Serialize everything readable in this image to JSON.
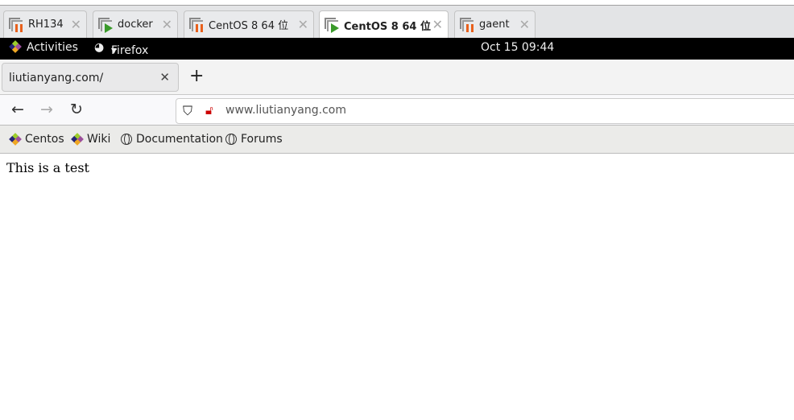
{
  "vm_tabs": [
    {
      "label": "RH134",
      "state": "paused"
    },
    {
      "label": "docker",
      "state": "running"
    },
    {
      "label": "CentOS 8 64 位",
      "state": "paused"
    },
    {
      "label": "CentOS 8 64 位",
      "state": "running",
      "active": true
    },
    {
      "label": "gaent",
      "state": "paused"
    }
  ],
  "gnome": {
    "activities": "Activities",
    "app": "Firefox",
    "clock": "Oct 15  09:44"
  },
  "browser": {
    "tab_title": "liutianyang.com/",
    "url": "www.liutianyang.com",
    "bookmarks": [
      "Centos",
      "Wiki",
      "Documentation",
      "Forums"
    ]
  },
  "page": {
    "text": "This is a test"
  },
  "colors": {
    "paused": "#e8601c",
    "running": "#3a9a2a"
  }
}
